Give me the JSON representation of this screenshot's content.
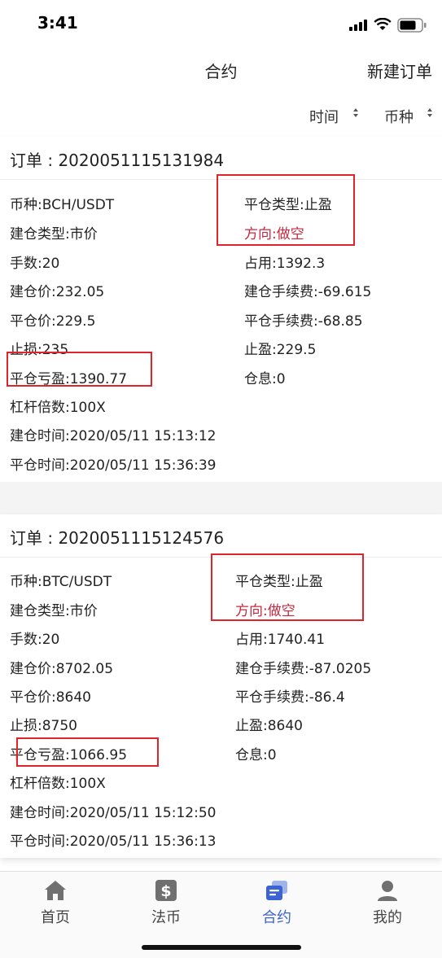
{
  "status_bar": {
    "time": "3:41"
  },
  "header": {
    "title": "合约",
    "new_order": "新建订单"
  },
  "filters": {
    "time": "时间",
    "currency": "币种"
  },
  "orders": [
    {
      "order_no": "订单 : 2020051115131984",
      "coin": "币种:BCH/USDT",
      "close_type": "平仓类型:止盈",
      "open_type": "建仓类型:市价",
      "direction": "方向:做空",
      "lots": "手数:20",
      "occupied": "占用:1392.3",
      "open_price": "建仓价:232.05",
      "open_fee": "建仓手续费:-69.615",
      "close_price": "平仓价:229.5",
      "close_fee": "平仓手续费:-68.85",
      "stop_loss": "止损:235",
      "take_profit": "止盈:229.5",
      "pnl": "平仓亏盈:1390.77",
      "swap": "仓息:0",
      "leverage": "杠杆倍数:100X",
      "open_time": "建仓时间:2020/05/11 15:13:12",
      "close_time": "平仓时间:2020/05/11 15:36:39"
    },
    {
      "order_no": "订单 : 2020051115124576",
      "coin": "币种:BTC/USDT",
      "close_type": "平仓类型:止盈",
      "open_type": "建仓类型:市价",
      "direction": "方向:做空",
      "lots": "手数:20",
      "occupied": "占用:1740.41",
      "open_price": "建仓价:8702.05",
      "open_fee": "建仓手续费:-87.0205",
      "close_price": "平仓价:8640",
      "close_fee": "平仓手续费:-86.4",
      "stop_loss": "止损:8750",
      "take_profit": "止盈:8640",
      "pnl": "平仓亏盈:1066.95",
      "swap": "仓息:0",
      "leverage": "杠杆倍数:100X",
      "open_time": "建仓时间:2020/05/11 15:12:50",
      "close_time": "平仓时间:2020/05/11 15:36:13"
    }
  ],
  "tabbar": [
    {
      "label": "首页",
      "icon": "home-icon"
    },
    {
      "label": "法币",
      "icon": "dollar-icon"
    },
    {
      "label": "合约",
      "icon": "contract-icon",
      "active": true
    },
    {
      "label": "我的",
      "icon": "user-icon"
    }
  ],
  "colors": {
    "accent": "#3b63d3",
    "direction": "#c8283c",
    "highlight_box": "#e0242c"
  }
}
